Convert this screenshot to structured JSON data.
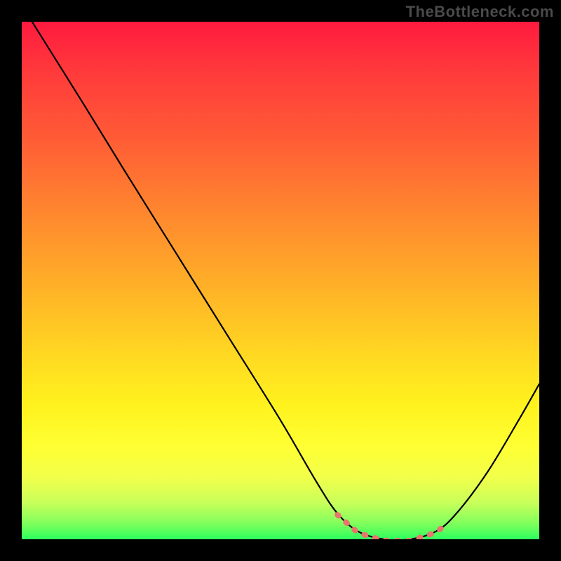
{
  "watermark": "TheBottleneck.com",
  "chart_data": {
    "type": "line",
    "title": "",
    "xlabel": "",
    "ylabel": "",
    "xlim": [
      0,
      100
    ],
    "ylim": [
      0,
      100
    ],
    "grid": false,
    "legend": null,
    "curve_points": [
      {
        "x": 2,
        "y": 100
      },
      {
        "x": 7,
        "y": 92
      },
      {
        "x": 12,
        "y": 84
      },
      {
        "x": 20,
        "y": 71
      },
      {
        "x": 30,
        "y": 55
      },
      {
        "x": 40,
        "y": 39
      },
      {
        "x": 50,
        "y": 23
      },
      {
        "x": 57,
        "y": 11
      },
      {
        "x": 61,
        "y": 5
      },
      {
        "x": 65,
        "y": 1.5
      },
      {
        "x": 70,
        "y": 0
      },
      {
        "x": 75,
        "y": 0
      },
      {
        "x": 80,
        "y": 1.5
      },
      {
        "x": 84,
        "y": 5
      },
      {
        "x": 90,
        "y": 13
      },
      {
        "x": 96,
        "y": 23
      },
      {
        "x": 100,
        "y": 30
      }
    ],
    "trough_marker_x_range": [
      61,
      82
    ],
    "colors": {
      "curve": "#000000",
      "trough_marker": "#e9746d",
      "gradient_top": "#ff1a3f",
      "gradient_bottom": "#2cff5e"
    }
  }
}
